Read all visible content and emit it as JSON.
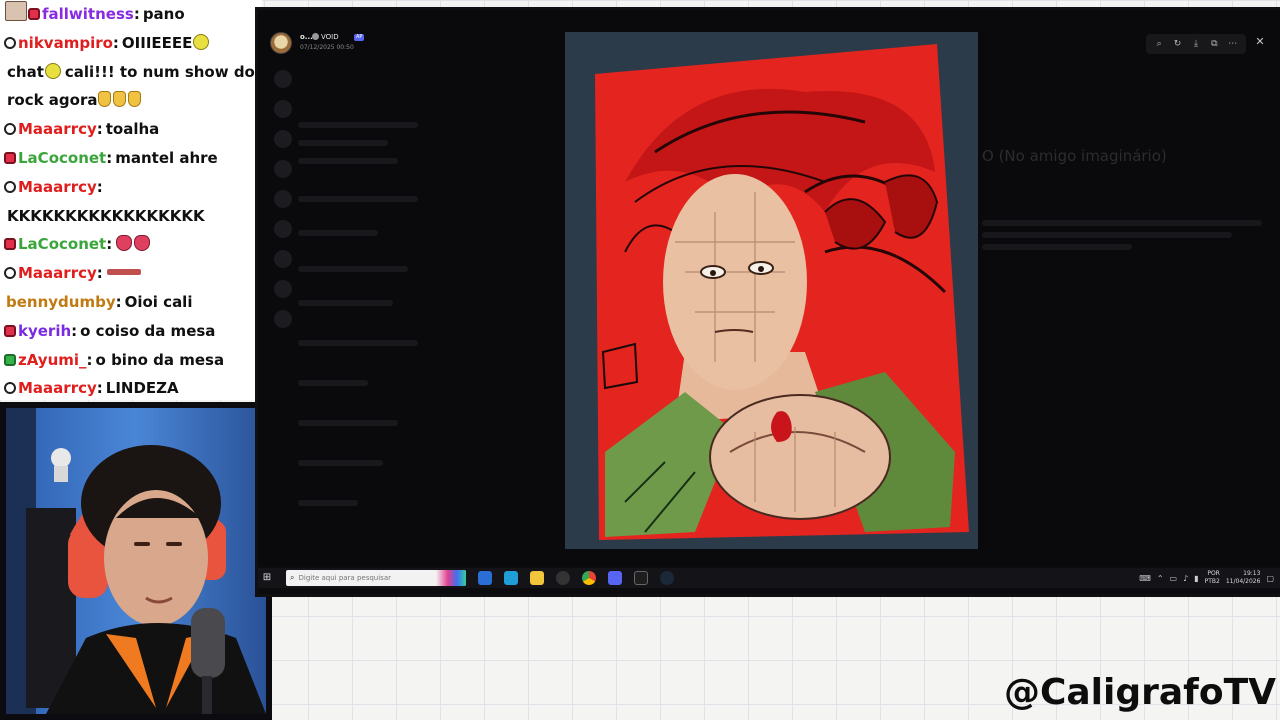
{
  "chat": {
    "messages": [
      {
        "badge": "red",
        "name": "fallwitness",
        "name_color": "#8a2be2",
        "text": "pano",
        "emote_before": "photo"
      },
      {
        "badge": "gray",
        "name": "nikvampiro",
        "name_color": "#e01e1e",
        "text": "OIIIEEEE",
        "emote_after": "smile"
      },
      {
        "badge": "none",
        "name": "",
        "name_color": "#111111",
        "text": "chat",
        "emote_after": "smile",
        "text2": "cali!!! to num show do"
      },
      {
        "badge": "none",
        "name": "",
        "name_color": "#111111",
        "text": "rock agora",
        "emote_after": "hands"
      },
      {
        "badge": "gray",
        "name": "Maaarrcy",
        "name_color": "#e01e1e",
        "text": "toalha"
      },
      {
        "badge": "red",
        "name": "LaCoconet",
        "name_color": "#3aa53a",
        "text": "mantel ahre"
      },
      {
        "badge": "gray",
        "name": "Maaarrcy",
        "name_color": "#e01e1e",
        "text": ""
      },
      {
        "badge": "none",
        "name": "",
        "name_color": "#111111",
        "text": "KKKKKKKKKKKKKKKKK"
      },
      {
        "badge": "red",
        "name": "LaCoconet",
        "name_color": "#3aa53a",
        "text": "",
        "emote_after": "pink"
      },
      {
        "badge": "gray",
        "name": "Maaarrcy",
        "name_color": "#e01e1e",
        "text": "",
        "emote_after": "dash"
      },
      {
        "badge": "none",
        "name": "bennydumby",
        "name_color": "#c07a12",
        "text": "Oioi cali"
      },
      {
        "badge": "red",
        "name": "kyerih",
        "name_color": "#7a2be2",
        "text": "o coiso da mesa"
      },
      {
        "badge": "green",
        "name": "zAyumi_",
        "name_color": "#e01e1e",
        "text": "o bino da mesa"
      },
      {
        "badge": "gray",
        "name": "Maaarrcy",
        "name_color": "#e01e1e",
        "text": "LINDEZA"
      }
    ]
  },
  "viewer": {
    "user": "o...",
    "server": "VOID",
    "tag": "AP",
    "date": "07/12/2025 00:50",
    "background_title": "O (No amigo imaginário)"
  },
  "toolbar": {
    "icons": [
      "zoom-icon",
      "rotate-icon",
      "download-icon",
      "open-icon",
      "more-icon"
    ],
    "close_icon": "close-icon"
  },
  "taskbar": {
    "search_placeholder": "Digite aqui para pesquisar",
    "lang": "POR",
    "lang2": "PTB2",
    "time": "19:13",
    "date": "11/04/2026"
  },
  "brand": "@CaligrafoTV",
  "colors": {
    "artwork_red": "#e0241e",
    "background_grid": "#dfe2e6",
    "screen_dark": "#0c0c0e"
  }
}
